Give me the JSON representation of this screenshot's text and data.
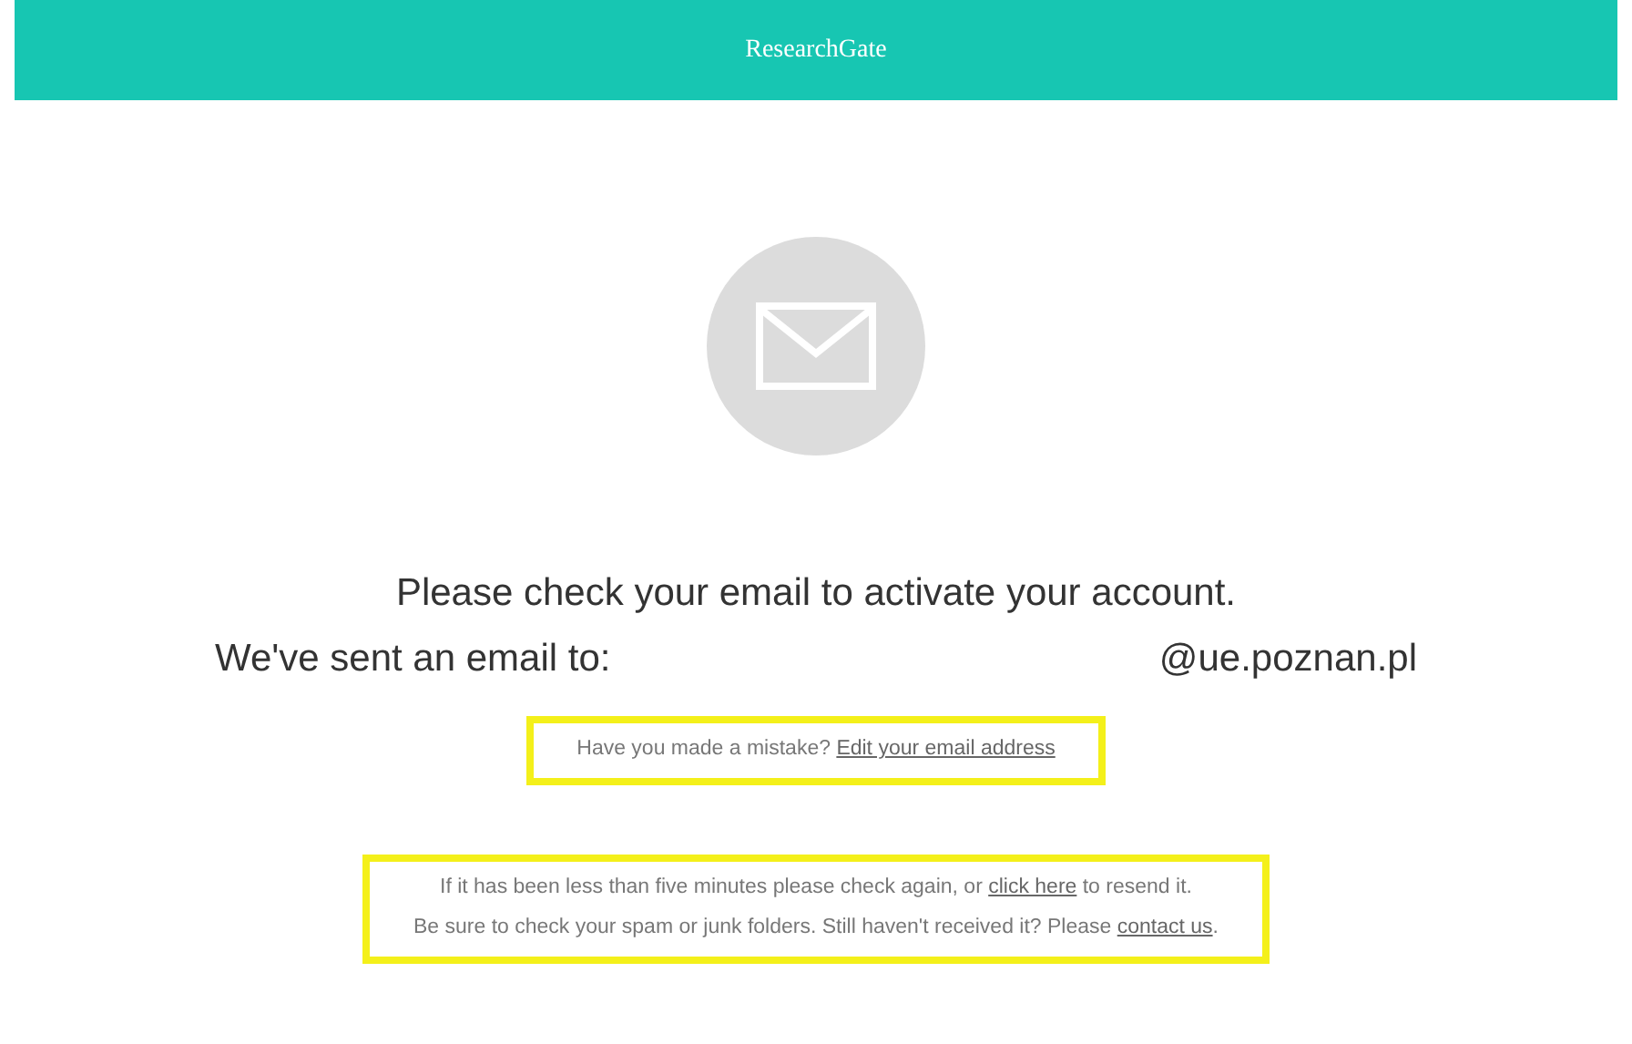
{
  "header": {
    "brand": "ResearchGate"
  },
  "heading": "Please check your email to activate your account.",
  "sent_line": {
    "label": "We've sent an email to:",
    "email": "@ue.poznan.pl"
  },
  "mistake_note": {
    "highlighted": true,
    "parts": [
      {
        "kind": "text",
        "text": "Have you made a mistake? "
      },
      {
        "kind": "link",
        "text": "Edit your email address"
      }
    ]
  },
  "resend_note": {
    "highlighted": true,
    "lines": [
      [
        {
          "kind": "text",
          "text": "If it has been less than five minutes please check again, or "
        },
        {
          "kind": "link",
          "text": "click here"
        },
        {
          "kind": "text",
          "text": " to resend it."
        }
      ],
      [
        {
          "kind": "text",
          "text": "Be sure to check your spam or junk folders. Still haven't received it? Please "
        },
        {
          "kind": "link",
          "text": "contact us"
        },
        {
          "kind": "text",
          "text": "."
        }
      ]
    ]
  }
}
